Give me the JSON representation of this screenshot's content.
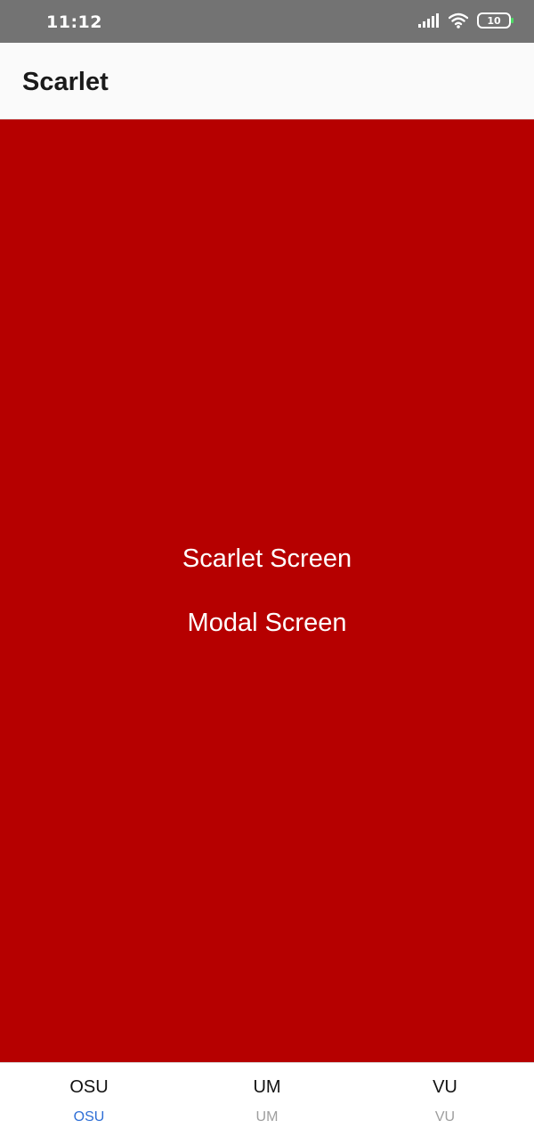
{
  "status_bar": {
    "time": "11:12",
    "battery": "10"
  },
  "header": {
    "title": "Scarlet"
  },
  "main": {
    "background": "#b60000",
    "links": [
      {
        "label": "Scarlet Screen"
      },
      {
        "label": "Modal Screen"
      }
    ]
  },
  "tabs": [
    {
      "title": "OSU",
      "label": "OSU",
      "active": true
    },
    {
      "title": "UM",
      "label": "UM",
      "active": false
    },
    {
      "title": "VU",
      "label": "VU",
      "active": false
    }
  ],
  "colors": {
    "accent": "#2f6fd6",
    "inactive": "#9e9e9e"
  },
  "icons": [
    "signal-icon",
    "wifi-icon",
    "battery-icon"
  ]
}
